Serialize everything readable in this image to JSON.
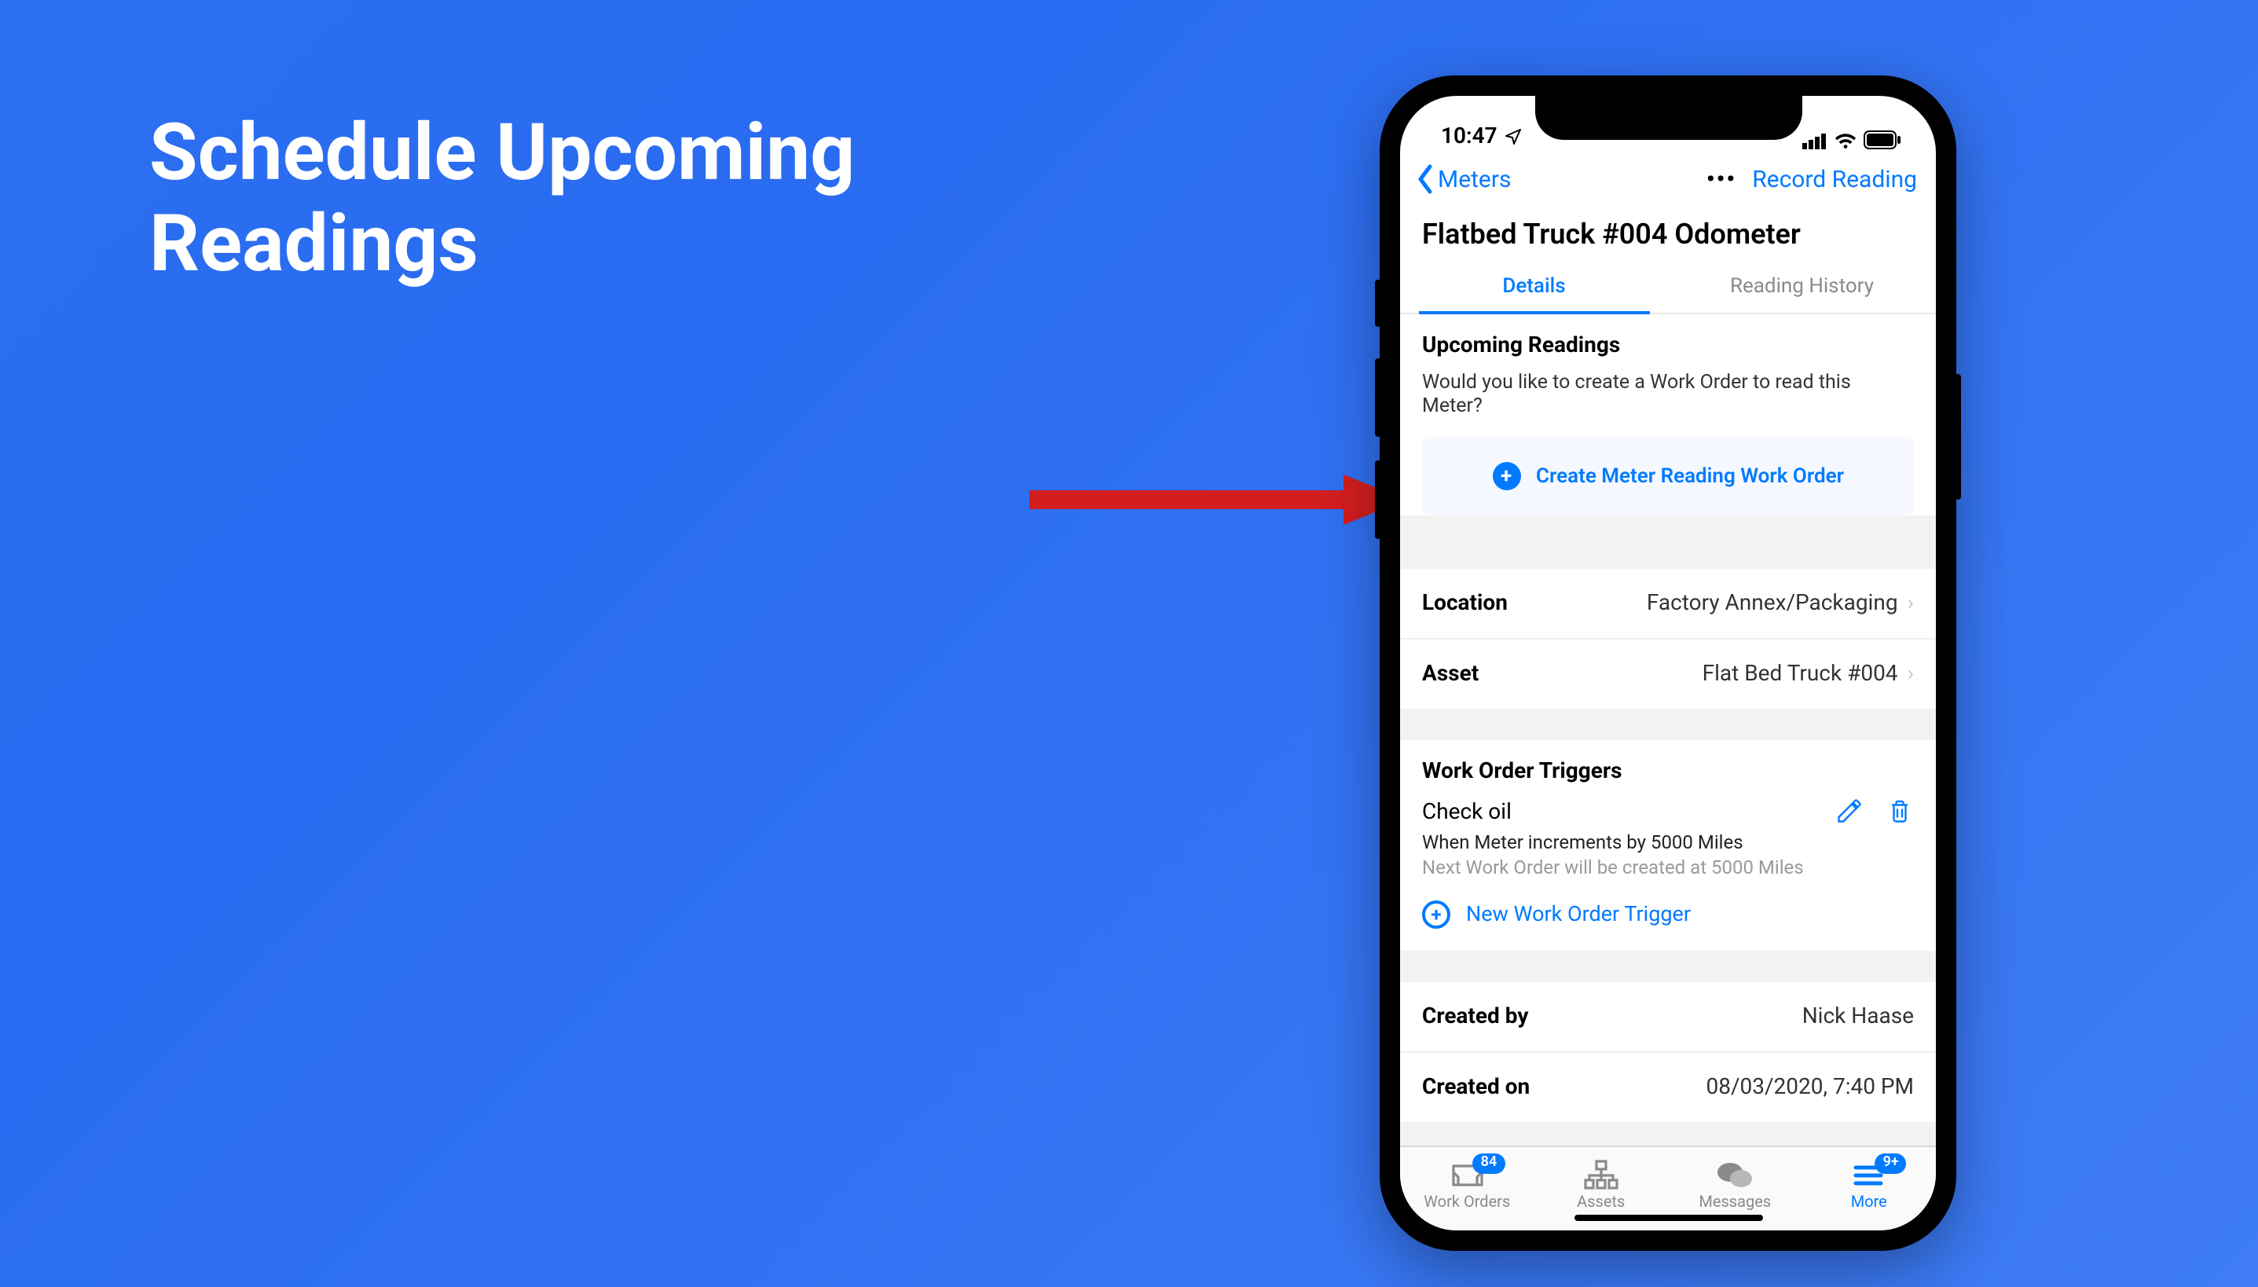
{
  "slide": {
    "title": "Schedule Upcoming Readings"
  },
  "statusbar": {
    "time": "10:47"
  },
  "nav": {
    "back_label": "Meters",
    "action_label": "Record Reading"
  },
  "header": {
    "title": "Flatbed Truck #004 Odometer"
  },
  "tabs": {
    "details": "Details",
    "history": "Reading History"
  },
  "upcoming": {
    "heading": "Upcoming Readings",
    "subtext": "Would you like to create a Work Order to read this Meter?",
    "cta_label": "Create Meter Reading Work Order"
  },
  "rows": {
    "location": {
      "key": "Location",
      "value": "Factory Annex/Packaging"
    },
    "asset": {
      "key": "Asset",
      "value": "Flat Bed Truck #004"
    }
  },
  "triggers": {
    "heading": "Work Order Triggers",
    "item": {
      "name": "Check oil",
      "condition": "When Meter increments by 5000 Miles",
      "next": "Next Work Order will be created at 5000 Miles"
    },
    "new_label": "New Work Order Trigger"
  },
  "meta": {
    "created_by": {
      "key": "Created by",
      "value": "Nick Haase"
    },
    "created_on": {
      "key": "Created on",
      "value": "08/03/2020, 7:40 PM"
    }
  },
  "tabbar": {
    "work_orders": {
      "label": "Work Orders",
      "badge": "84"
    },
    "assets": {
      "label": "Assets"
    },
    "messages": {
      "label": "Messages"
    },
    "more": {
      "label": "More",
      "badge": "9+"
    }
  }
}
